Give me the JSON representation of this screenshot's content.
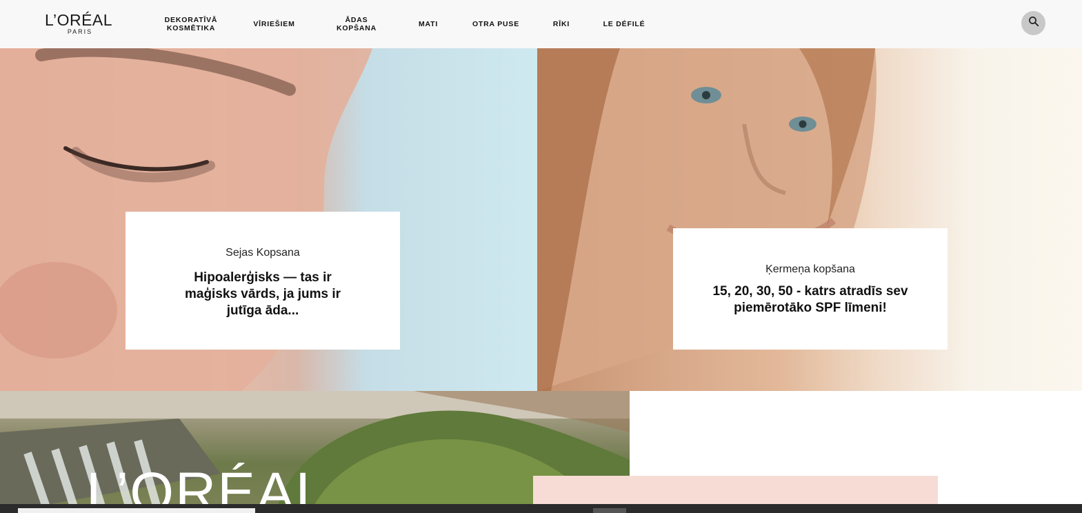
{
  "header": {
    "logo": {
      "main": "L’ORÉAL",
      "sub": "PARIS"
    },
    "nav": [
      {
        "label": "DEKORATĪVĀ KOSMĒTIKA"
      },
      {
        "label": "VĪRIEŠIEM"
      },
      {
        "label": "ĀDAS KOPŠANA"
      },
      {
        "label": "MATI"
      },
      {
        "label": "OTRA PUSE"
      },
      {
        "label": "RĪKI"
      },
      {
        "label": "LE DÉFILÉ"
      }
    ],
    "search_icon": "search-icon"
  },
  "cards": [
    {
      "category": "Sejas Kopsana",
      "title": "Hipoalerģisks — tas ir maģisks vārds, ja jums ir jutīga āda..."
    },
    {
      "category": "Ķermeņa kopšana",
      "title": "15, 20, 30, 50 - katrs atradīs sev piemērotāko SPF līmeni!"
    }
  ],
  "banner": {
    "logo_text": "L’ORÉAL"
  },
  "colors": {
    "header_bg": "#f8f8f8",
    "search_bg": "#c8c8c8",
    "peach": "#f6dcd4",
    "card_bg": "#ffffff"
  }
}
